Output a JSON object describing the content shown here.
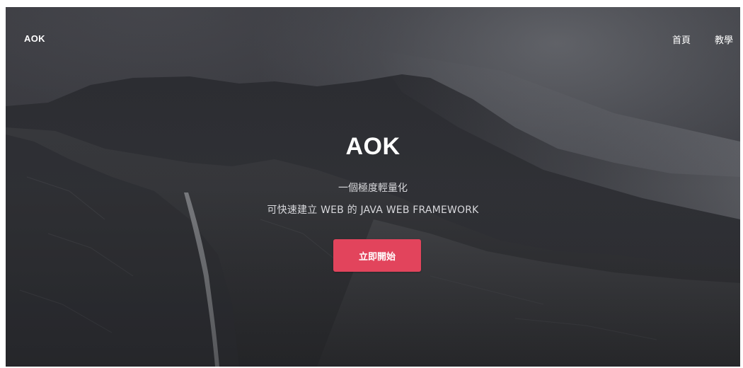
{
  "navbar": {
    "brand": "AOK",
    "links": [
      {
        "label": "首頁"
      },
      {
        "label": "教學"
      }
    ]
  },
  "hero": {
    "title": "AOK",
    "subtitle_line1": "一個極度輕量化",
    "subtitle_line2": "可快速建立 WEB 的 JAVA WEB FRAMEWORK",
    "cta_label": "立即開始"
  },
  "colors": {
    "accent": "#e2445c",
    "text": "#ffffff",
    "subtitle": "#d8d8dc"
  }
}
